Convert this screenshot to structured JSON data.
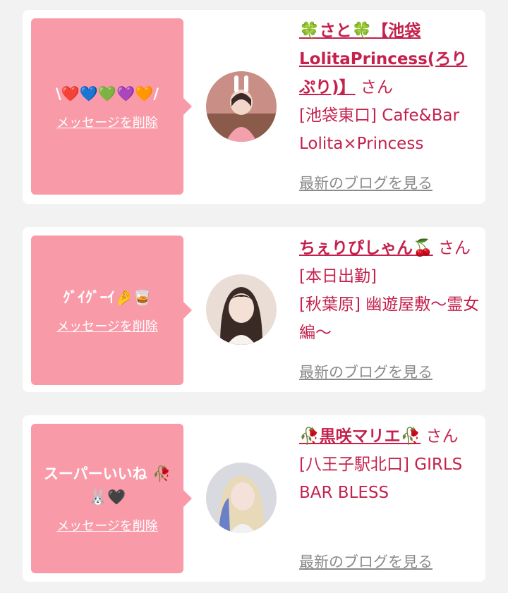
{
  "cards": [
    {
      "message": "\\❤️💙💚💜🧡⁠/",
      "delete_label": "メッセージを削除",
      "name": "🍀さと🍀【池袋LolitaPrincess(ろりぷり)】",
      "suffix": "さん",
      "shop": "[池袋東口] Cafe&Bar Lolita×Princess",
      "blog_label": "最新のブログを見る"
    },
    {
      "message": "ｸﾞｲｸﾞｰｲ🤌🥃",
      "delete_label": "メッセージを削除",
      "name": "ちぇりぴしゃん🍒",
      "suffix": "さん[本日出勤]",
      "shop": "[秋葉原] 幽遊屋敷～霊女編～",
      "blog_label": "最新のブログを見る"
    },
    {
      "message": "スーパーいいね 🥀🐰🖤",
      "delete_label": "メッセージを削除",
      "name": "🥀黒咲マリエ🥀",
      "suffix": "さん",
      "shop": "[八王子駅北口] GIRLS BAR BLESS",
      "blog_label": "最新のブログを見る"
    }
  ],
  "colors": {
    "bubble": "#f99aa9",
    "accent": "#c4214d",
    "blog_link": "#8a8a8a",
    "background": "#f2f2f2"
  }
}
